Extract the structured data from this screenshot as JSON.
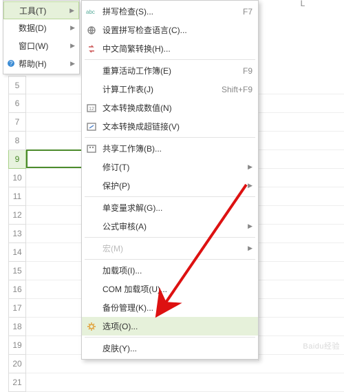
{
  "column_header": "L",
  "rows": [
    5,
    6,
    7,
    8,
    9,
    10,
    11,
    12,
    13,
    14,
    15,
    16,
    17,
    18,
    19,
    20,
    21
  ],
  "selected_row": 9,
  "menu": {
    "items": [
      {
        "label": "工具(T)",
        "has_sub": true,
        "highlight": true,
        "icon": ""
      },
      {
        "label": "数据(D)",
        "has_sub": true,
        "highlight": false,
        "icon": ""
      },
      {
        "label": "窗口(W)",
        "has_sub": true,
        "highlight": false,
        "icon": ""
      },
      {
        "label": "帮助(H)",
        "has_sub": true,
        "highlight": false,
        "icon": "help"
      }
    ]
  },
  "submenu": {
    "items": [
      {
        "label": "拼写检查(S)...",
        "icon": "abc",
        "shortcut": "F7"
      },
      {
        "label": "设置拼写检查语言(C)...",
        "icon": "globe"
      },
      {
        "label": "中文简繁转换(H)...",
        "icon": "convert"
      },
      {
        "sep": true
      },
      {
        "label": "重算活动工作簿(E)",
        "shortcut": "F9"
      },
      {
        "label": "计算工作表(J)",
        "shortcut": "Shift+F9"
      },
      {
        "label": "文本转换成数值(N)",
        "icon": "tonum"
      },
      {
        "label": "文本转换成超链接(V)",
        "icon": "tolink"
      },
      {
        "sep": true
      },
      {
        "label": "共享工作簿(B)...",
        "icon": "share"
      },
      {
        "label": "修订(T)",
        "has_sub": true
      },
      {
        "label": "保护(P)",
        "has_sub": true
      },
      {
        "sep": true
      },
      {
        "label": "单变量求解(G)..."
      },
      {
        "label": "公式审核(A)",
        "has_sub": true
      },
      {
        "sep": true
      },
      {
        "label": "宏(M)",
        "has_sub": true,
        "disabled": true
      },
      {
        "sep": true
      },
      {
        "label": "加载项(I)..."
      },
      {
        "label": "COM 加载项(U)..."
      },
      {
        "label": "备份管理(K)..."
      },
      {
        "label": "选项(O)...",
        "icon": "gear",
        "highlight": true
      },
      {
        "sep": true
      },
      {
        "label": "皮肤(Y)..."
      }
    ]
  },
  "watermark": "Baidu经验"
}
